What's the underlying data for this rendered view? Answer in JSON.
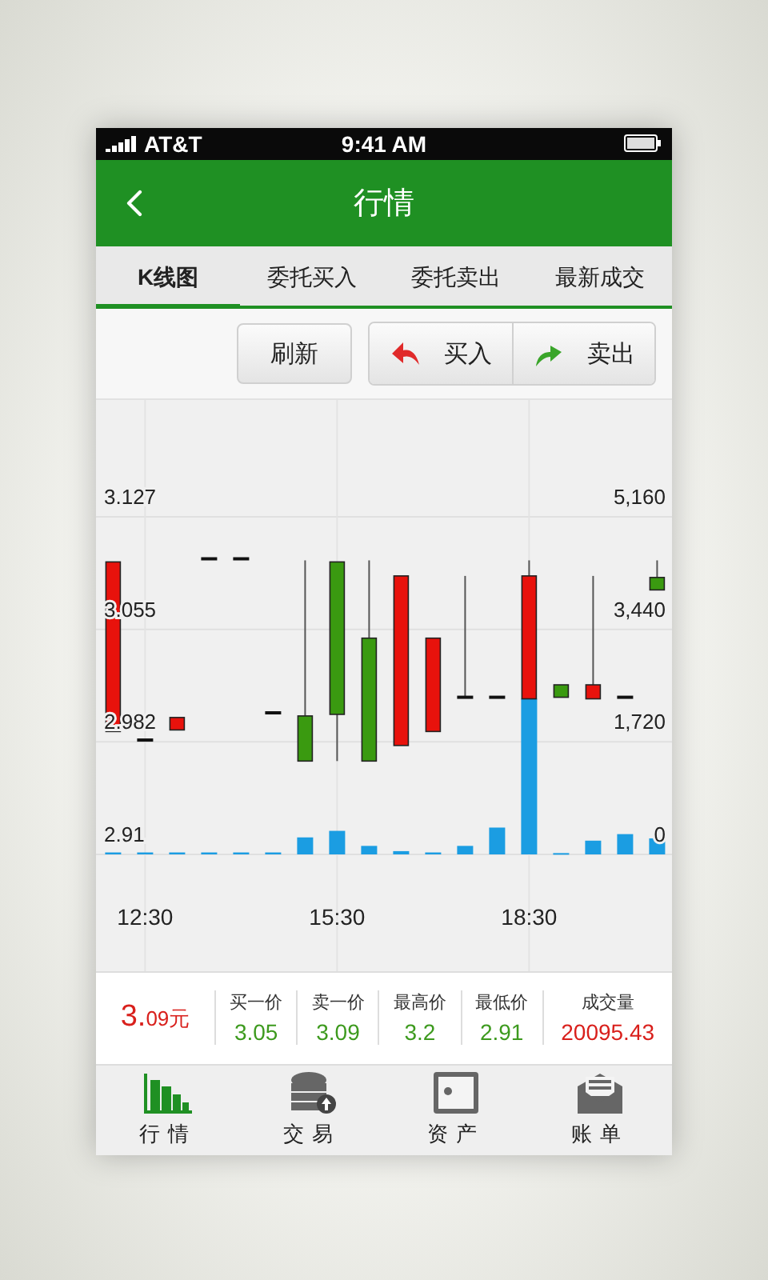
{
  "status_bar": {
    "carrier": "AT&T",
    "time": "9:41 AM"
  },
  "header": {
    "title": "行情"
  },
  "tabs": [
    {
      "label": "K线图",
      "selected": true
    },
    {
      "label": "委托买入",
      "selected": false
    },
    {
      "label": "委托卖出",
      "selected": false
    },
    {
      "label": "最新成交",
      "selected": false
    }
  ],
  "toolbar": {
    "refresh": "刷新",
    "actions": [
      {
        "kind": "buy",
        "label": "买入"
      },
      {
        "kind": "sell",
        "label": "卖出"
      }
    ]
  },
  "chart": {
    "price_axis": [
      "3.127",
      "3.055",
      "2.982",
      "2.91"
    ],
    "volume_axis": [
      "5,160",
      "3,440",
      "1,720",
      "0"
    ],
    "time_axis": [
      "12:30",
      "15:30",
      "18:30"
    ]
  },
  "summary": {
    "price": "3.09元",
    "stats": [
      {
        "label": "买一价",
        "value": "3.05",
        "color": "#3d9a1e"
      },
      {
        "label": "卖一价",
        "value": "3.09",
        "color": "#3d9a1e"
      },
      {
        "label": "最高价",
        "value": "3.2",
        "color": "#3d9a1e"
      },
      {
        "label": "最低价",
        "value": "2.91",
        "color": "#3d9a1e"
      },
      {
        "label": "成交量",
        "value": "20095.43",
        "color": "#d9201c"
      }
    ]
  },
  "bottom_nav": [
    {
      "kind": "market",
      "label": "行情",
      "selected": true
    },
    {
      "kind": "trade",
      "label": "交易",
      "selected": false
    },
    {
      "kind": "assets",
      "label": "资产",
      "selected": false
    },
    {
      "kind": "bills",
      "label": "账单",
      "selected": false
    }
  ]
}
